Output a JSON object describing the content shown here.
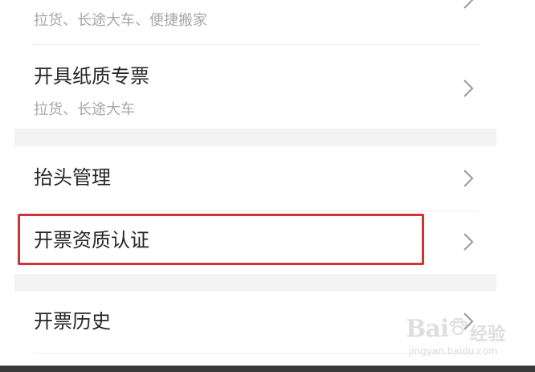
{
  "items": [
    {
      "title": "",
      "subtitle": "拉货、长途大车、便捷搬家"
    },
    {
      "title": "开具纸质专票",
      "subtitle": "拉货、长途大车"
    },
    {
      "title": "抬头管理"
    },
    {
      "title": "开票资质认证"
    },
    {
      "title": "开票历史"
    }
  ],
  "watermark": {
    "brand": "Bai",
    "brand_suffix": "经验",
    "url": "jingyan.baidu.com"
  },
  "colors": {
    "highlight": "#d0323a",
    "section_gap": "#f3f3f3",
    "title_text": "#262626",
    "subtitle_text": "#a7a7a7"
  }
}
